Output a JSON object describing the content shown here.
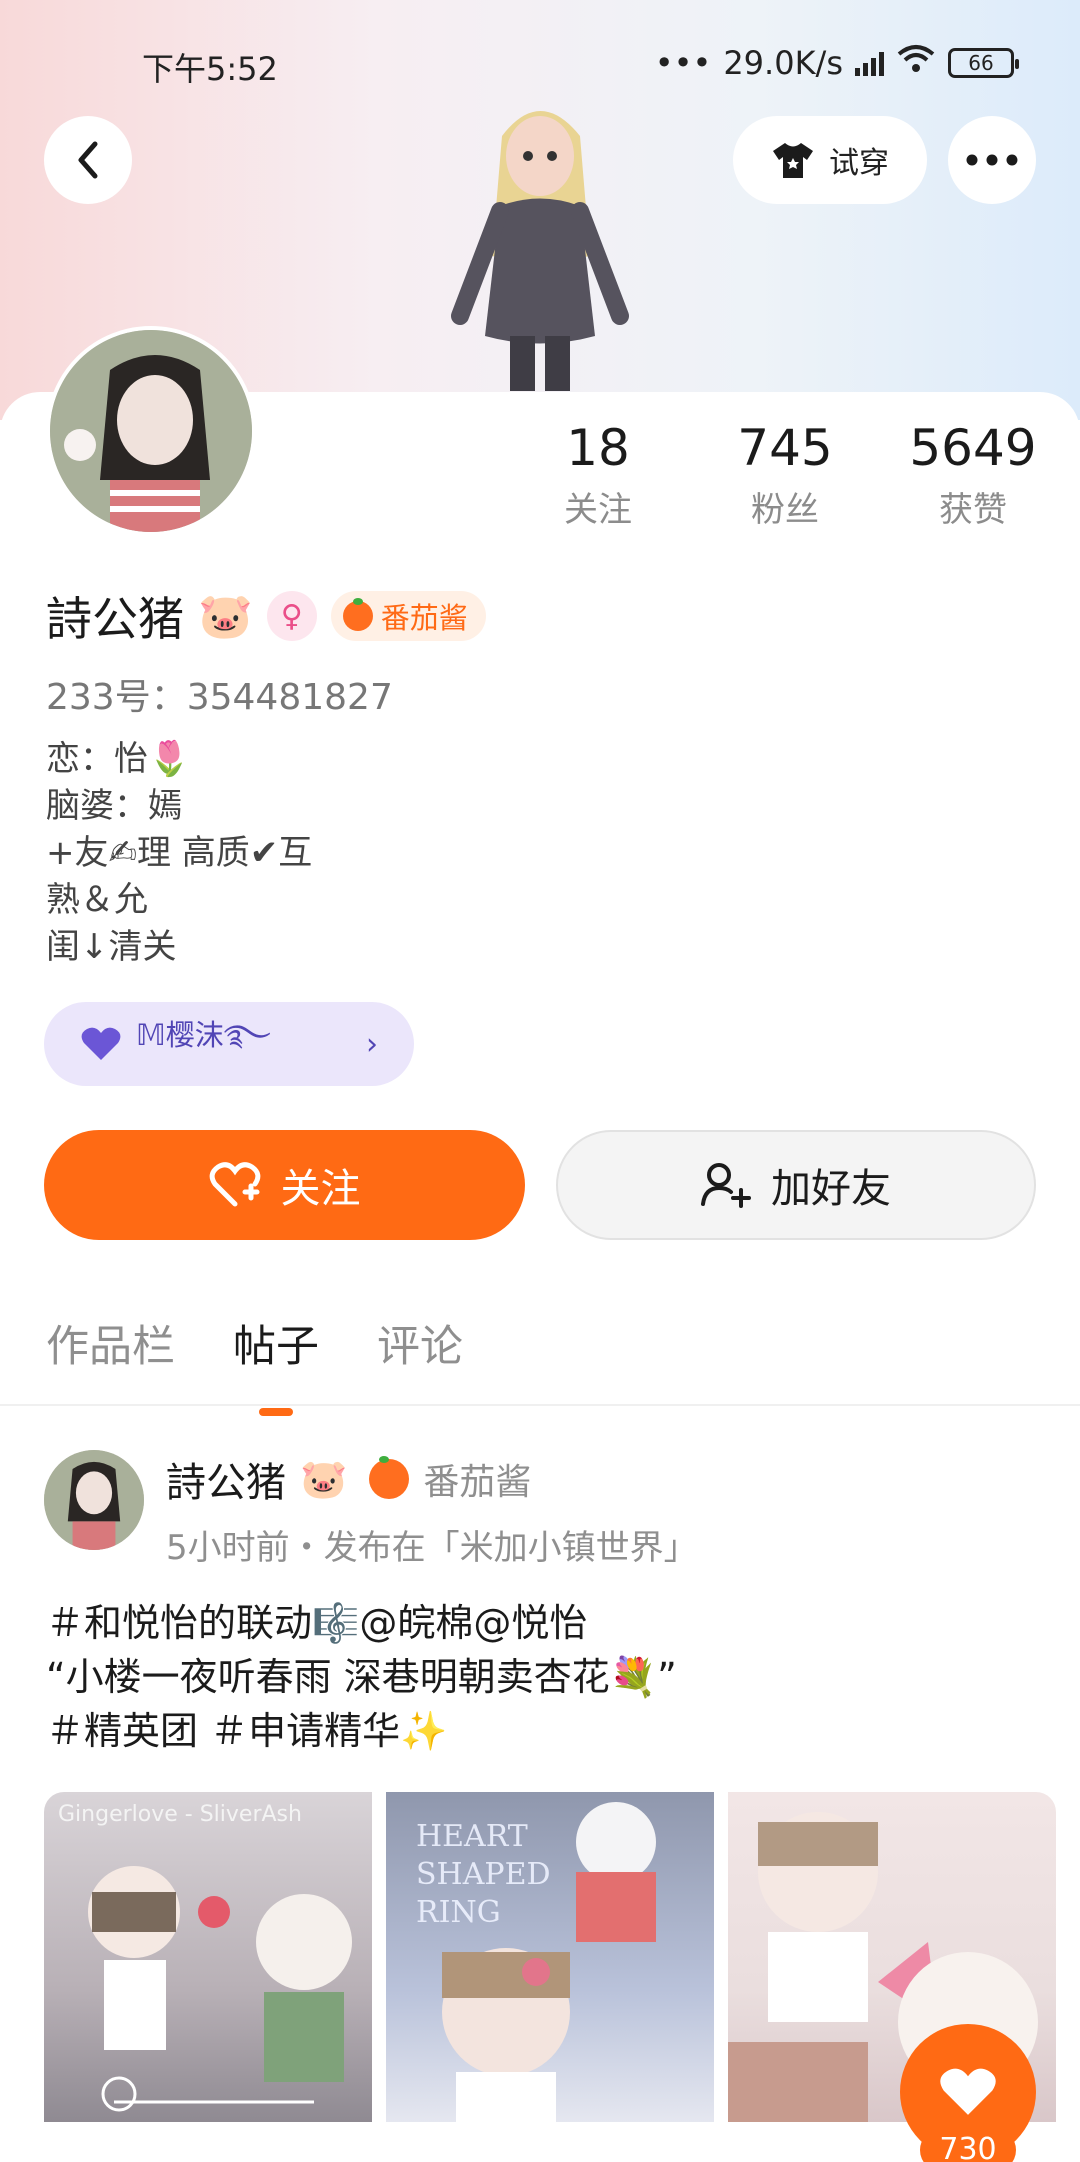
{
  "status_bar": {
    "time": "下午5:52",
    "net_speed": "29.0K/s",
    "battery": "66"
  },
  "header": {
    "tryon_label": "试穿"
  },
  "stats": [
    {
      "value": "18",
      "label": "关注"
    },
    {
      "value": "745",
      "label": "粉丝"
    },
    {
      "value": "5649",
      "label": "获赞"
    }
  ],
  "profile": {
    "name": "詩公猪",
    "tag": "番茄酱",
    "uid": "233号：354481827",
    "bio": "恋：怡🌷\n脑婆：嫣\n+友✍理 高质✔互\n熟＆允\n闺↓清关",
    "fanclub": "𝕄樱沫࿐"
  },
  "actions": {
    "follow": "关注",
    "add_friend": "加好友"
  },
  "tabs": [
    {
      "label": "作品栏"
    },
    {
      "label": "帖子"
    },
    {
      "label": "评论"
    }
  ],
  "post": {
    "author": "詩公猪",
    "tag": "番茄酱",
    "meta": "5小时前・发布在「米加小镇世界」",
    "text": "＃和悦怡的联动🎼@皖棉@悦怡\n“小楼一夜听春雨 深巷明朝卖杏花💐”\n＃精英团 ＃申请精华✨",
    "thumb1_caption": "Gingerlove - SliverAsh",
    "thumb2_caption": "HEART\nSHAPED\nRING",
    "likes": "730"
  },
  "colors": {
    "accent": "#ff6a14",
    "fanclub_bg": "#ebe6fb"
  }
}
